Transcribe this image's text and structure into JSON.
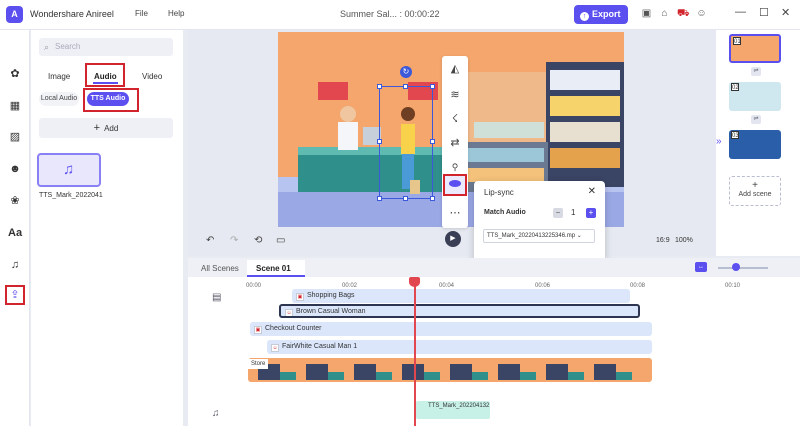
{
  "app": {
    "name": "Wondershare Anireel",
    "menu": [
      "File",
      "Help"
    ],
    "doc_title": "Summer Sal... : 00:00:22",
    "export_label": "Export",
    "window_controls": [
      "—",
      "☐",
      "✕"
    ]
  },
  "sidebar": {
    "icons": [
      "palette-icon",
      "image-icon",
      "texture-icon",
      "person-icon",
      "flower-icon",
      "text-icon",
      "music-icon",
      "tts-icon"
    ]
  },
  "panel": {
    "search_placeholder": "Search",
    "tabs": [
      "Image",
      "Audio",
      "Video"
    ],
    "active_tab": "Audio",
    "chips": [
      "Local Audio",
      "TTS Audio"
    ],
    "add_label": "Add",
    "clip_name": "TTS_Mark_2022041"
  },
  "stage": {
    "zoom_ratio": "16:9",
    "zoom_percent": "100%"
  },
  "lipsync": {
    "title": "Lip-sync",
    "match_audio_label": "Match Audio",
    "count": "1",
    "selected_audio": "TTS_Mark_20220413225346.mp"
  },
  "scenes": {
    "numbers": [
      "01",
      "02",
      "03"
    ],
    "add_label": "Add scene"
  },
  "timeline": {
    "tabs": [
      "All Scenes",
      "Scene 01"
    ],
    "ruler": [
      "00:00",
      "00:02",
      "00:04",
      "00:06",
      "00:08",
      "00:10"
    ],
    "layers": [
      {
        "name": "Shopping Bags"
      },
      {
        "name": "Brown Casual Woman"
      },
      {
        "name": "Checkout Counter"
      },
      {
        "name": "FairWhite Casual Man 1"
      }
    ],
    "store_label": "Store",
    "audio_clip": "TTS_Mark_202204132"
  }
}
